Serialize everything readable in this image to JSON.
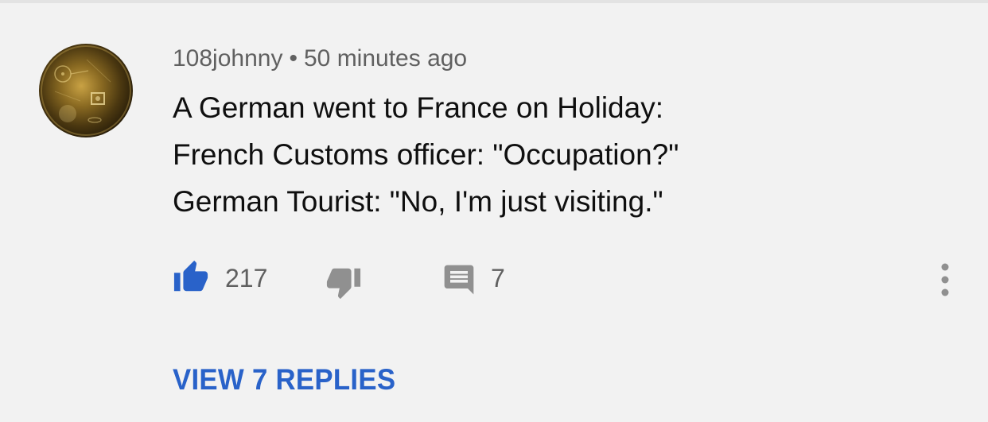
{
  "comment": {
    "author": "108johnny",
    "separator": "•",
    "timestamp": "50 minutes ago",
    "lines": [
      "A German went to France on Holiday:",
      "French Customs officer:  \"Occupation?\"",
      "German Tourist:  \"No, I'm just visiting.\""
    ],
    "like_count": "217",
    "reply_count": "7",
    "liked": true,
    "view_replies_label": "VIEW 7 REPLIES"
  },
  "colors": {
    "accent": "#2962c9",
    "icon_gray": "#909090",
    "meta_gray": "#606060",
    "text": "#0f0f0f",
    "background": "#f2f2f2"
  },
  "icons": {
    "like": "thumbs-up-icon",
    "dislike": "thumbs-down-icon",
    "reply": "comment-icon",
    "more": "more-vertical-icon"
  }
}
